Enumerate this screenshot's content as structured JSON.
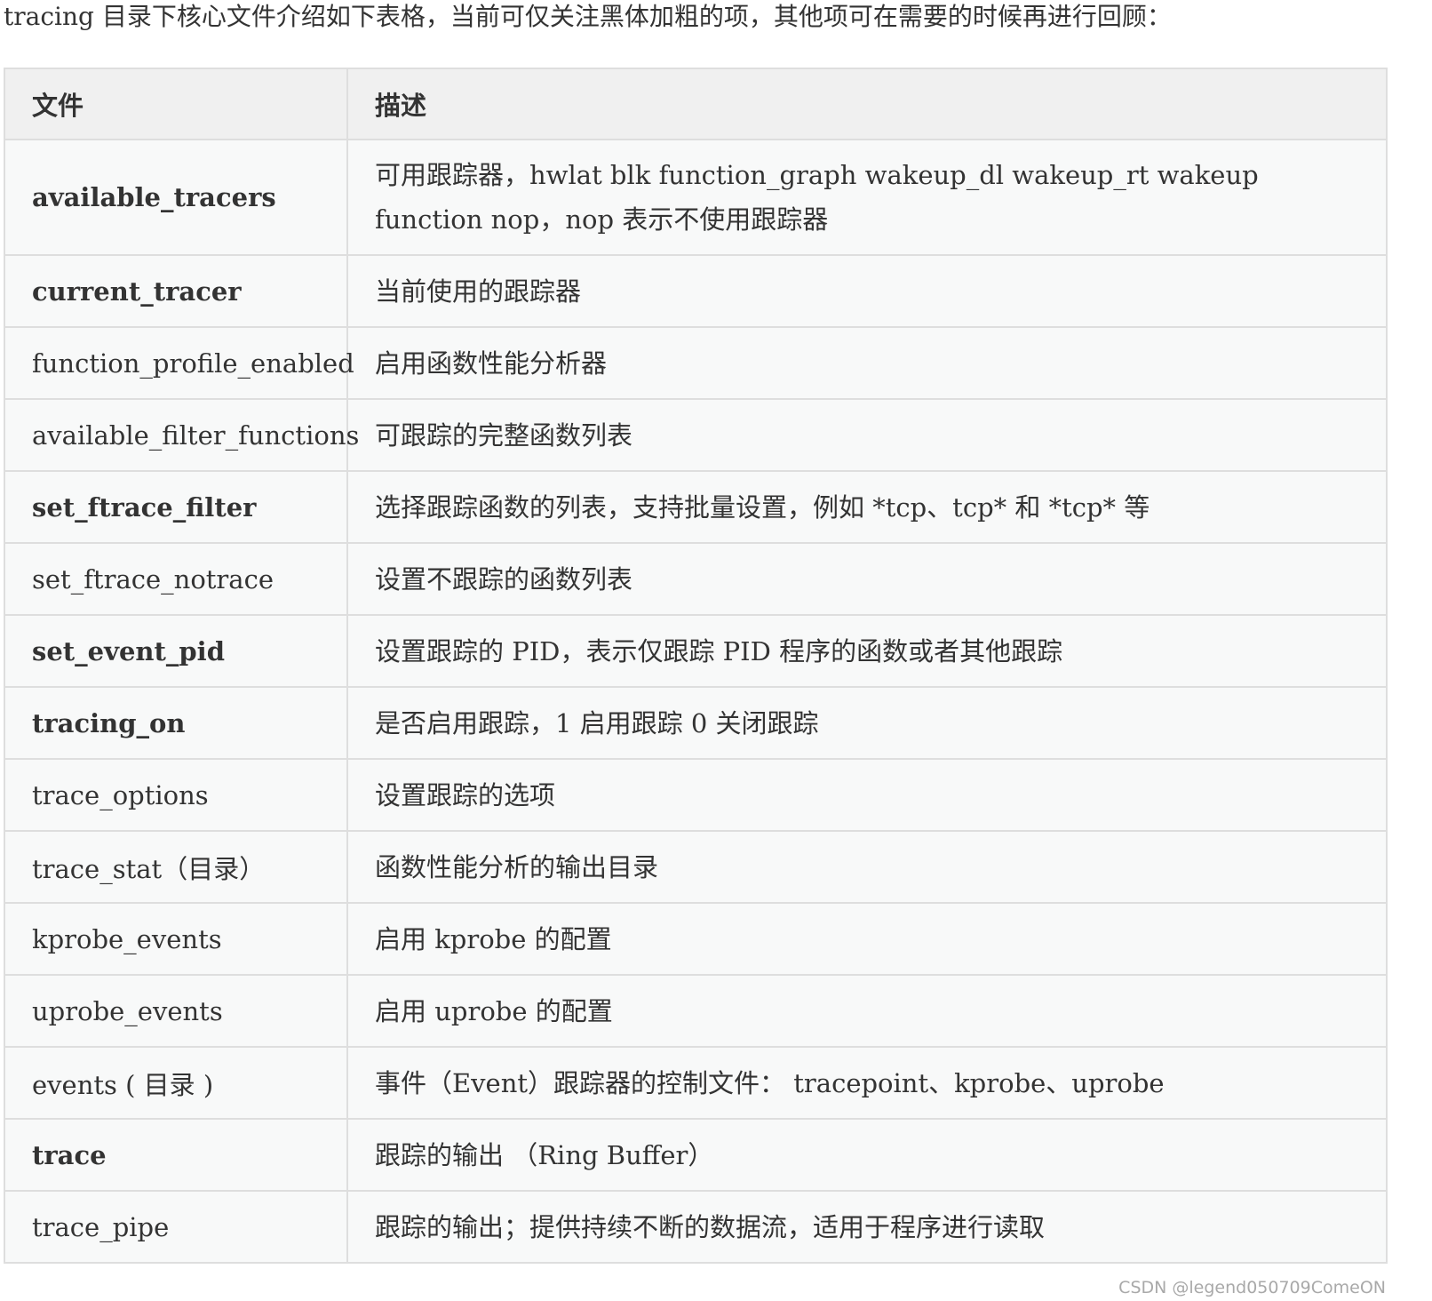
{
  "intro": "tracing 目录下核心文件介绍如下表格，当前可仅关注黑体加粗的项，其他项可在需要的时候再进行回顾：",
  "table": {
    "headers": [
      "文件",
      "描述"
    ],
    "rows": [
      {
        "file": "available_tracers",
        "bold": true,
        "desc": "可用跟踪器，hwlat blk function_graph wakeup_dl wakeup_rt wakeup function nop，nop 表示不使用跟踪器"
      },
      {
        "file": "current_tracer",
        "bold": true,
        "desc": "当前使用的跟踪器"
      },
      {
        "file": "function_profile_enabled",
        "bold": false,
        "desc": "启用函数性能分析器"
      },
      {
        "file": "available_filter_functions",
        "bold": false,
        "desc": "可跟踪的完整函数列表"
      },
      {
        "file": "set_ftrace_filter",
        "bold": true,
        "desc": "选择跟踪函数的列表，支持批量设置，例如 *tcp、tcp* 和 *tcp* 等"
      },
      {
        "file": "set_ftrace_notrace",
        "bold": false,
        "desc": "设置不跟踪的函数列表"
      },
      {
        "file": "set_event_pid",
        "bold": true,
        "desc": "设置跟踪的 PID，表示仅跟踪 PID 程序的函数或者其他跟踪"
      },
      {
        "file": "tracing_on",
        "bold": true,
        "desc": "是否启用跟踪，1 启用跟踪 0 关闭跟踪"
      },
      {
        "file": "trace_options",
        "bold": false,
        "desc": "设置跟踪的选项"
      },
      {
        "file": "trace_stat（目录）",
        "bold": false,
        "desc": "函数性能分析的输出目录"
      },
      {
        "file": "kprobe_events",
        "bold": false,
        "desc": "启用 kprobe 的配置"
      },
      {
        "file": "uprobe_events",
        "bold": false,
        "desc": "启用 uprobe 的配置"
      },
      {
        "file": "events ( 目录 )",
        "bold": false,
        "desc": "事件（Event）跟踪器的控制文件： tracepoint、kprobe、uprobe"
      },
      {
        "file": "trace",
        "bold": true,
        "desc": "跟踪的输出 （Ring Buffer）"
      },
      {
        "file": "trace_pipe",
        "bold": false,
        "desc": "跟踪的输出；提供持续不断的数据流，适用于程序进行读取"
      }
    ]
  },
  "watermark": "CSDN @legend050709ComeON"
}
